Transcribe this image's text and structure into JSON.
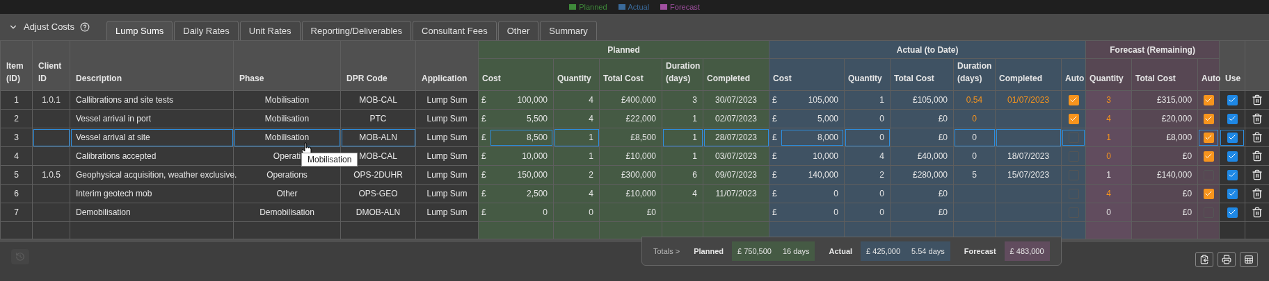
{
  "legend": [
    {
      "label": "Planned",
      "color": "#3f8a3a"
    },
    {
      "label": "Actual",
      "color": "#3a6a9a"
    },
    {
      "label": "Forecast",
      "color": "#a050a0"
    }
  ],
  "panel": {
    "title": "Adjust Costs",
    "expanded": true
  },
  "tabs": [
    {
      "label": "Lump Sums",
      "selected": true
    },
    {
      "label": "Daily Rates",
      "selected": false
    },
    {
      "label": "Unit Rates",
      "selected": false
    },
    {
      "label": "Reporting/Deliverables",
      "selected": false
    },
    {
      "label": "Consultant Fees",
      "selected": false
    },
    {
      "label": "Other",
      "selected": false
    },
    {
      "label": "Summary",
      "selected": false
    }
  ],
  "table": {
    "groups": {
      "planned": "Planned",
      "actual": "Actual (to Date)",
      "forecast": "Forecast (Remaining)"
    },
    "columns": {
      "item": "Item (ID)",
      "client_id": "Client ID",
      "description": "Description",
      "phase": "Phase",
      "dpr_code": "DPR Code",
      "application": "Application",
      "planned": [
        "Cost",
        "Quantity",
        "Total Cost",
        "Duration (days)",
        "Completed"
      ],
      "actual": [
        "Cost",
        "Quantity",
        "Total Cost",
        "Duration (days)",
        "Completed",
        "Auto"
      ],
      "forecast": [
        "Quantity",
        "Total Cost",
        "Auto"
      ],
      "use": "Use"
    },
    "rows": [
      {
        "item": "1",
        "client_id": "1.0.1",
        "description": "Callibrations and site tests",
        "phase": "Mobilisation",
        "dpr_code": "MOB-CAL",
        "application": "Lump Sum",
        "selected": false,
        "planned": {
          "currency": "£",
          "cost": "100,000",
          "quantity": "4",
          "total_cost": "£400,000",
          "duration": "3",
          "completed": "30/07/2023"
        },
        "actual": {
          "currency": "£",
          "cost": "105,000",
          "quantity": "1",
          "total_cost": "£105,000",
          "duration": "0.54",
          "completed": "01/07/2023",
          "auto": true
        },
        "forecast": {
          "quantity": "3",
          "total_cost": "£315,000",
          "auto": true
        },
        "use": true
      },
      {
        "item": "2",
        "description": "Vessel arrival in port",
        "phase": "Mobilisation",
        "dpr_code": "PTC",
        "application": "Lump Sum",
        "selected": false,
        "planned": {
          "currency": "£",
          "cost": "5,500",
          "quantity": "4",
          "total_cost": "£22,000",
          "duration": "1",
          "completed": "02/07/2023"
        },
        "actual": {
          "currency": "£",
          "cost": "5,000",
          "quantity": "0",
          "total_cost": "£0",
          "duration": "0",
          "auto": true
        },
        "forecast": {
          "quantity": "4",
          "total_cost": "£20,000",
          "auto": true
        },
        "use": true
      },
      {
        "item": "3",
        "description": "Vessel arrival at site",
        "phase": "Mobilisation",
        "dpr_code": "MOB-ALN",
        "application": "Lump Sum",
        "selected": true,
        "planned": {
          "currency": "£",
          "cost": "8,500",
          "quantity": "1",
          "total_cost": "£8,500",
          "duration": "1",
          "completed": "28/07/2023"
        },
        "actual": {
          "currency": "£",
          "cost": "8,000",
          "quantity": "0",
          "total_cost": "£0",
          "duration": "0",
          "auto": false
        },
        "forecast": {
          "quantity": "1",
          "total_cost": "£8,000",
          "auto": true
        },
        "use": true
      },
      {
        "item": "4",
        "description": "Calibrations accepted",
        "phase": "Operati",
        "dpr_code": "MOB-CAL",
        "application": "Lump Sum",
        "selected": false,
        "planned": {
          "currency": "£",
          "cost": "10,000",
          "quantity": "1",
          "total_cost": "£10,000",
          "duration": "1",
          "completed": "03/07/2023"
        },
        "actual": {
          "currency": "£",
          "cost": "10,000",
          "quantity": "4",
          "total_cost": "£40,000",
          "duration": "0",
          "completed": "18/07/2023",
          "auto": false
        },
        "forecast": {
          "quantity": "0",
          "total_cost": "£0",
          "auto": true
        },
        "use": true
      },
      {
        "item": "5",
        "client_id": "1.0.5",
        "description": "Geophysical acquisition, weather exclusive.",
        "phase": "Operations",
        "dpr_code": "OPS-2DUHR",
        "application": "Lump Sum",
        "selected": false,
        "planned": {
          "currency": "£",
          "cost": "150,000",
          "quantity": "2",
          "total_cost": "£300,000",
          "duration": "6",
          "completed": "09/07/2023"
        },
        "actual": {
          "currency": "£",
          "cost": "140,000",
          "quantity": "2",
          "total_cost": "£280,000",
          "duration": "5",
          "completed": "15/07/2023",
          "auto": false
        },
        "forecast": {
          "quantity": "1",
          "total_cost": "£140,000",
          "auto": false
        },
        "use": true
      },
      {
        "item": "6",
        "description": "Interim geotech mob",
        "phase": "Other",
        "dpr_code": "OPS-GEO",
        "application": "Lump Sum",
        "selected": false,
        "planned": {
          "currency": "£",
          "cost": "2,500",
          "quantity": "4",
          "total_cost": "£10,000",
          "duration": "4",
          "completed": "11/07/2023"
        },
        "actual": {
          "currency": "£",
          "cost": "0",
          "quantity": "0",
          "total_cost": "£0",
          "auto": false
        },
        "forecast": {
          "quantity": "4",
          "total_cost": "£0",
          "auto": true
        },
        "use": true
      },
      {
        "item": "7",
        "description": "Demobilisation",
        "phase": "Demobilisation",
        "dpr_code": "DMOB-ALN",
        "application": "Lump Sum",
        "selected": false,
        "planned": {
          "currency": "£",
          "cost": "0",
          "quantity": "0",
          "total_cost": "£0"
        },
        "actual": {
          "currency": "£",
          "cost": "0",
          "quantity": "0",
          "total_cost": "£0",
          "auto": false
        },
        "forecast": {
          "quantity": "0",
          "total_cost": "£0",
          "auto": false
        },
        "use": true
      }
    ]
  },
  "tooltip": {
    "text": "Mobilisation"
  },
  "totals": {
    "label": "Totals >",
    "planned": {
      "label": "Planned",
      "cost": "£ 750,500",
      "duration": "16 days"
    },
    "actual": {
      "label": "Actual",
      "cost": "£ 425,000",
      "duration": "5.54 days"
    },
    "forecast": {
      "label": "Forecast",
      "cost": "£ 483,000"
    }
  },
  "history_button": {
    "disabled": true
  }
}
